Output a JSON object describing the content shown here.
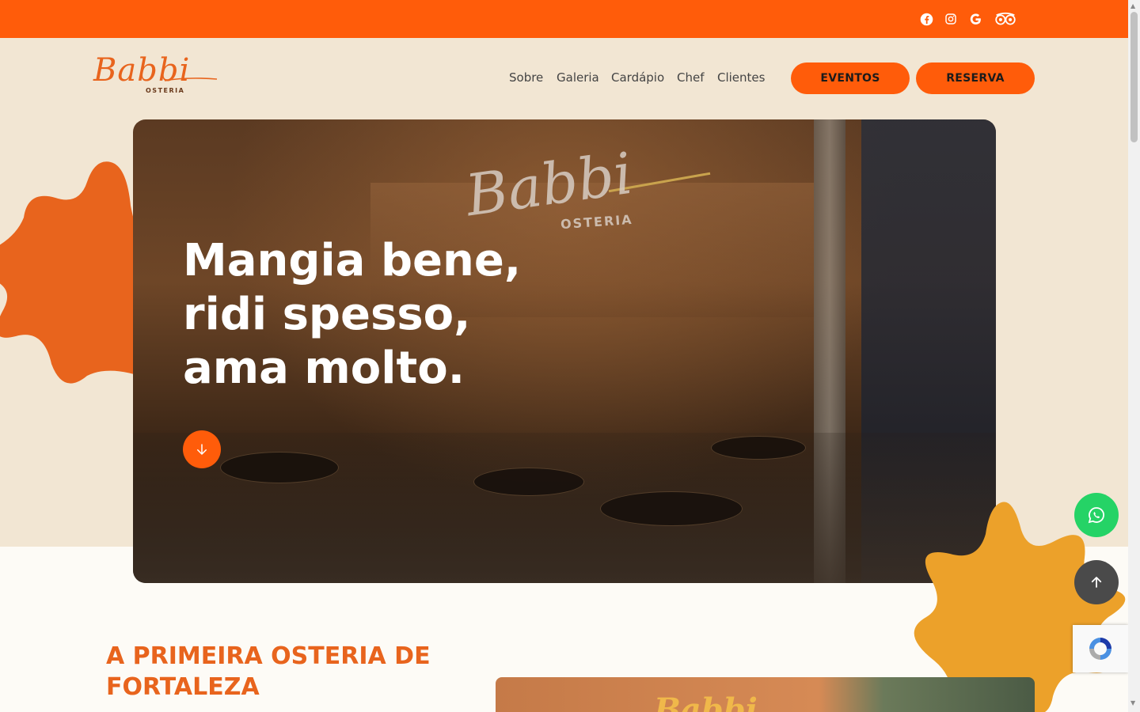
{
  "brand": {
    "logo_script": "Babbi",
    "logo_sub": "OSTERIA",
    "accent": "#ff5c0a",
    "orange_text": "#e8641d",
    "beige": "#f2e6d3",
    "yellow_blob": "#eca12a",
    "whatsapp_green": "#25d366"
  },
  "social": [
    {
      "icon": "facebook-icon"
    },
    {
      "icon": "instagram-icon"
    },
    {
      "icon": "google-icon"
    },
    {
      "icon": "tripadvisor-icon"
    }
  ],
  "nav": {
    "items": [
      {
        "label": "Sobre"
      },
      {
        "label": "Galeria"
      },
      {
        "label": "Cardápio"
      },
      {
        "label": "Chef"
      },
      {
        "label": "Clientes"
      }
    ],
    "events_label": "EVENTOS",
    "reserve_label": "RESERVA"
  },
  "hero": {
    "sign_text": "Babbi",
    "sign_sub": "OSTERIA",
    "title_lines": [
      "Mangia bene,",
      "ridi spesso,",
      "ama molto."
    ]
  },
  "about": {
    "title": "A PRIMEIRA OSTERIA DE FORTALEZA",
    "image_sign": "Babbi"
  }
}
